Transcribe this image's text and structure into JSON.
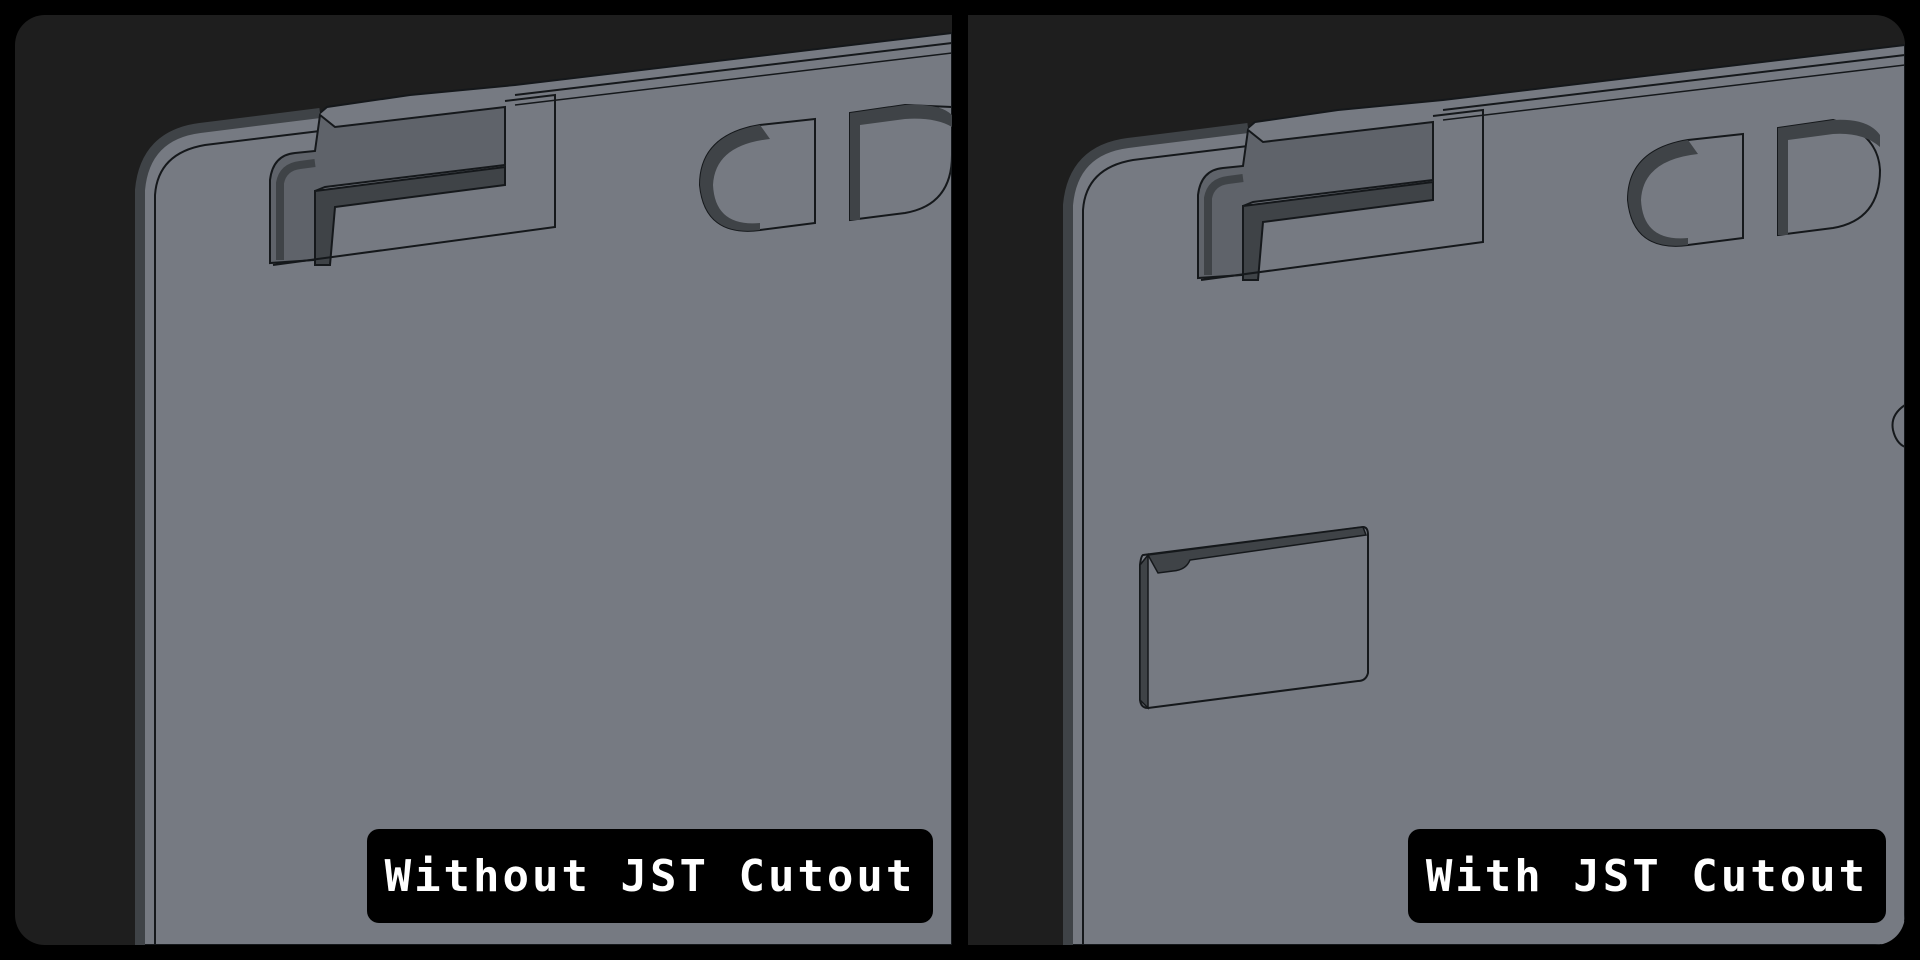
{
  "colors": {
    "background": "#1e1e1e",
    "plate": "#767a82",
    "edge_dark": "#3f4347",
    "outline": "#15181b",
    "border": "#000000",
    "caption_bg": "#000000",
    "caption_text": "#ffffff"
  },
  "panels": [
    {
      "caption": "Without JST Cutout",
      "has_jst_cutout": false
    },
    {
      "caption": "With JST Cutout",
      "has_jst_cutout": true
    }
  ]
}
